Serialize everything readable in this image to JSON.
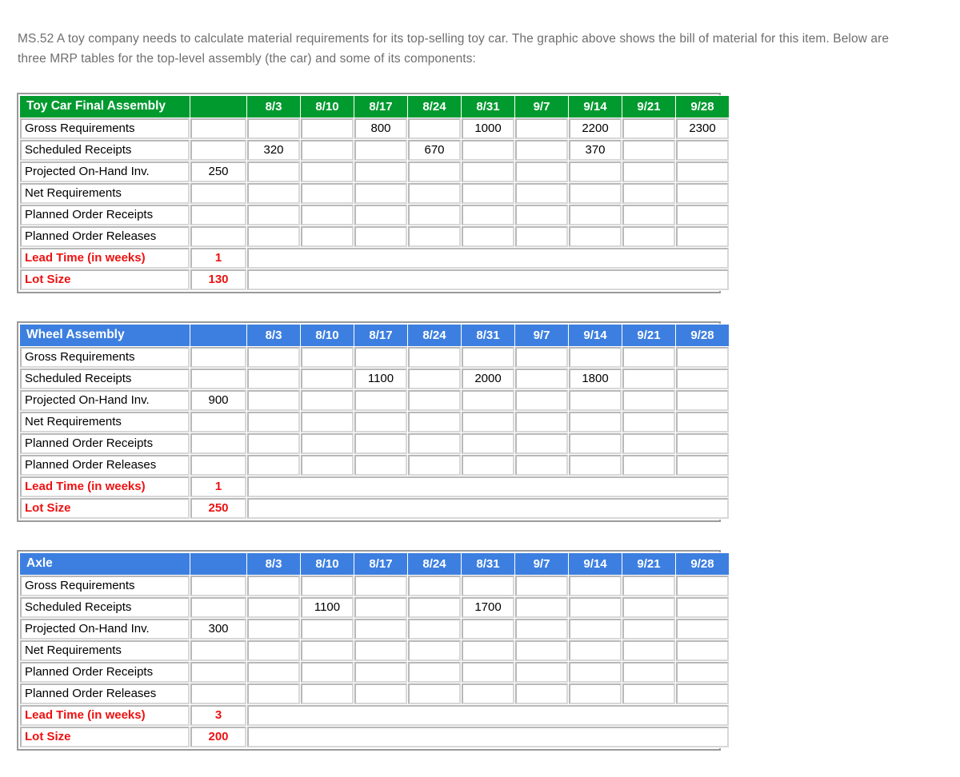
{
  "intro": {
    "text": "MS.52 A toy company needs to calculate material requirements for its top-selling toy car. The graphic above shows the bill of material for this item. Below are three MRP tables for the top-level assembly (the car) and some of its components:"
  },
  "colors": {
    "green_header": "#009a2e",
    "blue_header": "#3d7fe0",
    "param_red": "#ee1111",
    "mask_black": "#000000",
    "intro_gray": "#6e6e6e"
  },
  "weeks": [
    "8/3",
    "8/10",
    "8/17",
    "8/24",
    "8/31",
    "9/7",
    "9/14",
    "9/21",
    "9/28"
  ],
  "row_labels": {
    "gross": "Gross Requirements",
    "scheduled": "Scheduled Receipts",
    "onhand": "Projected On-Hand Inv.",
    "net": "Net Requirements",
    "por": "Planned Order Receipts",
    "pol": "Planned Order Releases",
    "lead": "Lead Time (in weeks)",
    "lot": "Lot Size"
  },
  "tables": [
    {
      "title": "Toy Car Final Assembly",
      "header_color": "green",
      "onhand_start": "250",
      "lead_time": "1",
      "lot_size": "130",
      "rows": {
        "gross": [
          "",
          "",
          "800",
          "",
          "1000",
          "",
          "2200",
          "",
          "2300"
        ],
        "scheduled": [
          "320",
          "",
          "",
          "670",
          "",
          "",
          "370",
          "",
          ""
        ],
        "onhand": [
          "",
          "",
          "",
          "",
          "",
          "",
          "",
          "",
          ""
        ],
        "net": [
          "",
          "",
          "",
          "",
          "",
          "",
          "",
          "",
          ""
        ],
        "por": [
          "",
          "",
          "",
          "",
          "",
          "",
          "",
          "",
          ""
        ],
        "pol": [
          "",
          "",
          "",
          "",
          "",
          "",
          "",
          "",
          ""
        ]
      }
    },
    {
      "title": "Wheel Assembly",
      "header_color": "blue",
      "onhand_start": "900",
      "lead_time": "1",
      "lot_size": "250",
      "rows": {
        "gross": [
          "",
          "",
          "",
          "",
          "",
          "",
          "",
          "",
          ""
        ],
        "scheduled": [
          "",
          "",
          "1100",
          "",
          "2000",
          "",
          "1800",
          "",
          ""
        ],
        "onhand": [
          "",
          "",
          "",
          "",
          "",
          "",
          "",
          "",
          ""
        ],
        "net": [
          "",
          "",
          "",
          "",
          "",
          "",
          "",
          "",
          ""
        ],
        "por": [
          "",
          "",
          "",
          "",
          "",
          "",
          "",
          "",
          ""
        ],
        "pol": [
          "",
          "",
          "",
          "",
          "",
          "",
          "",
          "",
          ""
        ]
      }
    },
    {
      "title": "Axle",
      "header_color": "blue",
      "onhand_start": "300",
      "lead_time": "3",
      "lot_size": "200",
      "rows": {
        "gross": [
          "",
          "",
          "",
          "",
          "",
          "",
          "",
          "",
          ""
        ],
        "scheduled": [
          "",
          "1100",
          "",
          "",
          "1700",
          "",
          "",
          "",
          ""
        ],
        "onhand": [
          "",
          "",
          "",
          "",
          "",
          "",
          "",
          "",
          ""
        ],
        "net": [
          "",
          "",
          "",
          "",
          "",
          "",
          "",
          "",
          ""
        ],
        "por": [
          "",
          "",
          "",
          "",
          "",
          "",
          "",
          "",
          ""
        ],
        "pol": [
          "",
          "",
          "",
          "",
          "",
          "",
          "",
          "",
          ""
        ]
      }
    }
  ]
}
